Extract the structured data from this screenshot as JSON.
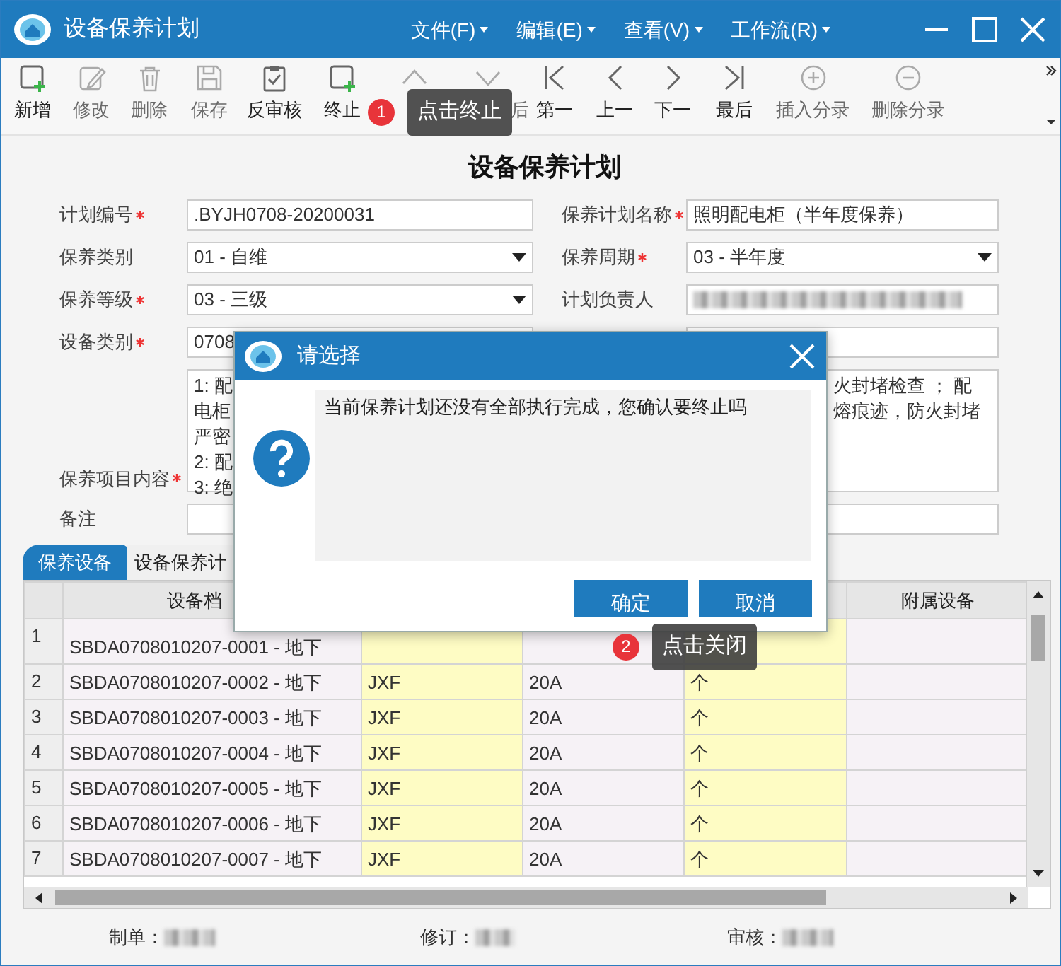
{
  "window": {
    "title": "设备保养计划"
  },
  "menu": [
    {
      "label": "文件(F)"
    },
    {
      "label": "编辑(E)"
    },
    {
      "label": "查看(V)"
    },
    {
      "label": "工作流(R)"
    }
  ],
  "toolbar": [
    {
      "label": "新增",
      "disabled": false
    },
    {
      "label": "修改",
      "disabled": true
    },
    {
      "label": "删除",
      "disabled": true
    },
    {
      "label": "保存",
      "disabled": true
    },
    {
      "label": "反审核",
      "disabled": false
    },
    {
      "label": "终止",
      "disabled": false
    },
    {
      "disabled": true
    },
    {
      "label": "后",
      "disabled": true
    },
    {
      "label": "第一",
      "disabled": false
    },
    {
      "label": "上一",
      "disabled": false
    },
    {
      "label": "下一",
      "disabled": false
    },
    {
      "label": "最后",
      "disabled": false
    },
    {
      "label": "插入分录",
      "disabled": true
    },
    {
      "label": "删除分录",
      "disabled": true
    }
  ],
  "form": {
    "title": "设备保养计划",
    "fields": [
      {
        "label": "计划编号",
        "required": true,
        "kind": "text",
        "value": ".BYJH0708-20200031"
      },
      {
        "label": "保养计划名称",
        "required": true,
        "kind": "text",
        "value": "照明配电柜（半年度保养）"
      },
      {
        "label": "保养类别",
        "required": false,
        "kind": "select",
        "value": "01 - 自维"
      },
      {
        "label": "保养周期",
        "required": true,
        "kind": "select",
        "value": "03 - 半年度"
      },
      {
        "label": "保养等级",
        "required": true,
        "kind": "select",
        "value": "03 - 三级"
      },
      {
        "label": "计划负责人",
        "required": false,
        "kind": "text",
        "redacted": true
      },
      {
        "label": "设备类别",
        "required": true,
        "kind": "text",
        "value": "0708"
      },
      {
        "kind": "text"
      },
      {
        "label": "保养项目内容",
        "required": true,
        "kind": "textarea",
        "lines_left": [
          "1: 配",
          "电柜",
          "严密",
          "2: 配",
          "3: 绝"
        ],
        "lines_right": [
          "火封堵检查 ； 配",
          "熔痕迹，防火封堵"
        ]
      },
      {
        "label": "备注",
        "required": false,
        "kind": "text"
      }
    ]
  },
  "tabs": [
    {
      "label": "保养设备",
      "selected": true
    },
    {
      "label": "设备保养计",
      "selected": false
    }
  ],
  "grid": {
    "columns": [
      {
        "label": "设备档"
      },
      {},
      {},
      {},
      {
        "label": "附属设备"
      }
    ],
    "rows": [
      {
        "n": "1",
        "cells": [
          "SBDA0708010207-0001 - 地下"
        ]
      },
      {
        "n": "2",
        "cells": [
          "SBDA0708010207-0002 - 地下",
          "JXF",
          "20A",
          "个"
        ]
      },
      {
        "n": "3",
        "cells": [
          "SBDA0708010207-0003 - 地下",
          "JXF",
          "20A",
          "个"
        ]
      },
      {
        "n": "4",
        "cells": [
          "SBDA0708010207-0004 - 地下",
          "JXF",
          "20A",
          "个"
        ]
      },
      {
        "n": "5",
        "cells": [
          "SBDA0708010207-0005 - 地下",
          "JXF",
          "20A",
          "个"
        ]
      },
      {
        "n": "6",
        "cells": [
          "SBDA0708010207-0006 - 地下",
          "JXF",
          "20A",
          "个"
        ]
      },
      {
        "n": "7",
        "cells": [
          "SBDA0708010207-0007 - 地下",
          "JXF",
          "20A",
          "个"
        ]
      }
    ]
  },
  "footer": [
    {
      "label": "制单：",
      "redacted": true
    },
    {
      "label": "修订：",
      "redacted": true
    },
    {
      "label": "审核：",
      "redacted": true
    }
  ],
  "dialog": {
    "title": "请选择",
    "message": "当前保养计划还没有全部执行完成，您确认要终止吗",
    "buttons": [
      {
        "label": "确定"
      },
      {
        "label": "取消"
      }
    ]
  },
  "tooltips": [
    {
      "badge": "1",
      "text": "点击终止"
    },
    {
      "badge": "2",
      "text": "点击关闭"
    }
  ]
}
